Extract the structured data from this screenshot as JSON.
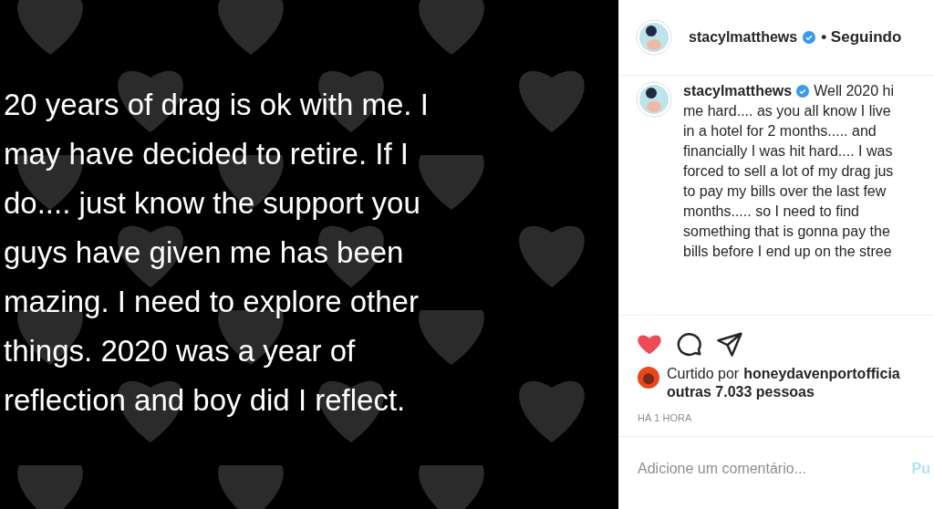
{
  "post_image": {
    "lines": [
      "20 years of drag is ok with me. I",
      "may have decided to retire. If I",
      "do.... just know the support you",
      "guys have given me has been",
      "mazing. I need to explore other",
      "things. 2020 was a year of",
      "reflection and boy did I reflect."
    ]
  },
  "header": {
    "username": "stacylmatthews",
    "verified": true,
    "follow_status": "• Seguindo"
  },
  "caption": {
    "username": "stacylmatthews",
    "verified": true,
    "lines": [
      "Well 2020 hi",
      "me hard.... as you all know I live",
      "in a hotel for 2 months..... and",
      "financially I was hit hard.... I was",
      "forced to sell a lot of my drag jus",
      "to pay my bills over the last few",
      "months..... so I need to find",
      "something that is gonna pay the",
      "bills before I end up on the stree"
    ]
  },
  "actions": {
    "liked": true
  },
  "likes": {
    "prefix": "Curtido por",
    "liker": "honeydavenportofficia",
    "others": "outras 7.033 pessoas"
  },
  "timestamp": "HÁ 1 HORA",
  "comment": {
    "placeholder": "Adicione um comentário...",
    "publish": "Pu"
  }
}
